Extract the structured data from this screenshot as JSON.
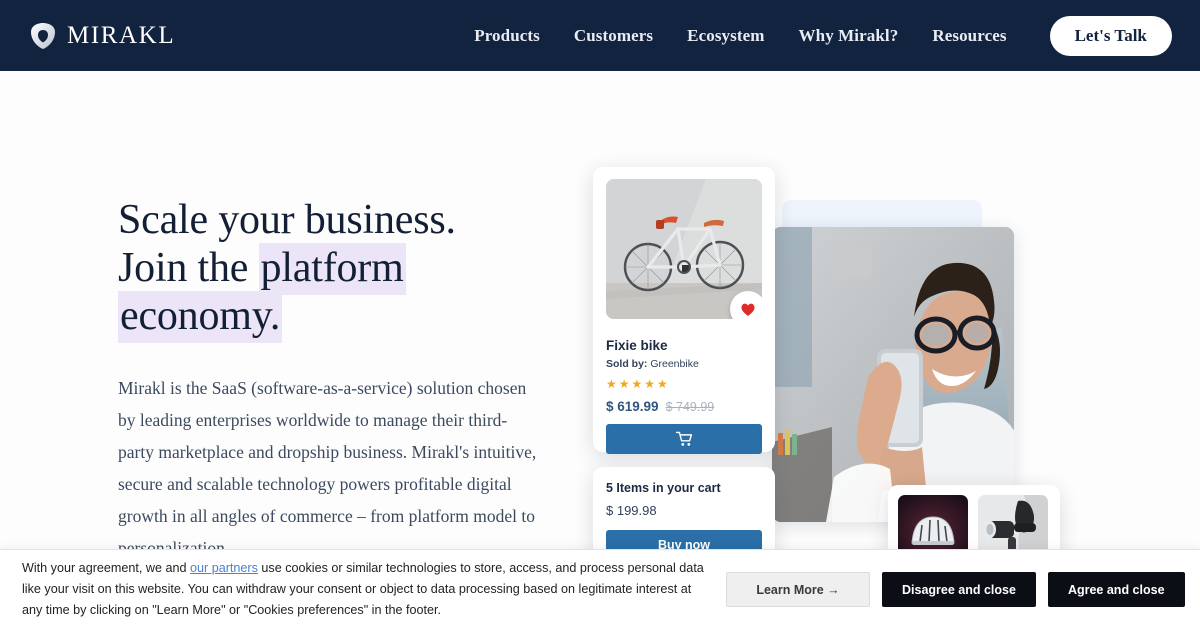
{
  "header": {
    "logo_text": "MIRAKL",
    "logo_icon": "shield-icon",
    "nav": [
      {
        "label": "Products"
      },
      {
        "label": "Customers"
      },
      {
        "label": "Ecosystem"
      },
      {
        "label": "Why Mirakl?"
      },
      {
        "label": "Resources"
      }
    ],
    "cta_label": "Let's Talk",
    "language_icon": "globe-icon",
    "language_chevron_icon": "chevron-down-icon",
    "background_color": "#11233f"
  },
  "hero": {
    "headline_line1": "Scale your business.",
    "headline_line2_plain": "Join the ",
    "headline_line2_highlight": "platform",
    "headline_line3_highlight": "economy.",
    "highlight_color": "#ece4f7",
    "body": "Mirakl is the SaaS (software-as-a-service) solution chosen by leading enterprises worldwide to manage their third-party marketplace and dropship business. Mirakl's intuitive, secure and scalable technology powers profitable digital growth in all angles of commerce – from platform model to personalization"
  },
  "product_card": {
    "image_alt": "fixie-bike-photo",
    "favorite_icon": "heart-icon",
    "title": "Fixie bike",
    "seller_label": "Sold by:",
    "seller_name": "Greenbike",
    "rating_stars": "★★★★★",
    "rating_value": 5,
    "price_current": "$ 619.99",
    "price_original": "$ 749.99",
    "cart_icon": "shopping-cart-icon",
    "button_color": "#2a6fa8"
  },
  "cart_card": {
    "title": "5 Items in your cart",
    "total": "$ 199.98",
    "buy_label": "Buy now"
  },
  "thumbs_card": {
    "items": [
      {
        "alt": "bike-helmet-thumbnail"
      },
      {
        "alt": "bike-light-thumbnail"
      }
    ]
  },
  "hero_photo": {
    "alt": "woman-with-glasses-holding-phone"
  },
  "cookie": {
    "text_before_link": "With your agreement, we and ",
    "link_label": "our partners",
    "text_after_link": " use cookies or similar technologies to store, access, and process personal data like your visit on this website. You can withdraw your consent or object to data processing based on legitimate interest at any time by clicking on \"Learn More\" or \"Cookies preferences\" in the footer.",
    "learn_more_label": "Learn More →",
    "disagree_label": "Disagree and close",
    "agree_label": "Agree and close"
  }
}
